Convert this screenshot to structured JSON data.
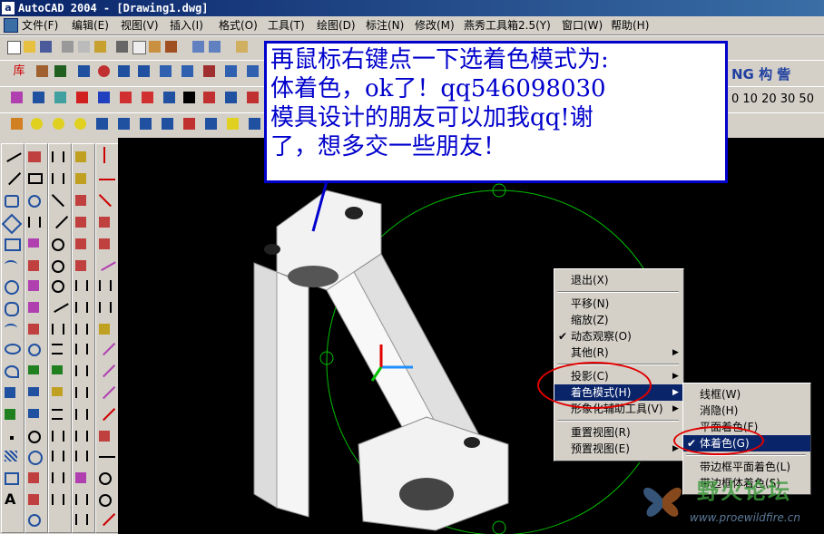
{
  "window": {
    "title": "AutoCAD 2004 - [Drawing1.dwg]",
    "app_icon": "a"
  },
  "menus": [
    "文件(F)",
    "编辑(E)",
    "视图(V)",
    "插入(I)",
    "格式(O)",
    "工具(T)",
    "绘图(D)",
    "标注(N)",
    "修改(M)",
    "燕秀工具箱2.5(Y)",
    "窗口(W)",
    "帮助(H)"
  ],
  "toolbar_right_text": {
    "ng": "NG 构 訾",
    "scale_numbers": "0 10 20 30 50"
  },
  "annotation": {
    "lines": [
      "再鼠标右键点一下选着色模式为:",
      "体着色，ok了！qq546098030",
      "模具设计的朋友可以加我qq!谢",
      "了，想多交一些朋友！"
    ],
    "color": "#0000cc"
  },
  "context_menu": {
    "items": [
      {
        "label": "退出(X)"
      },
      {
        "label": "平移(N)"
      },
      {
        "label": "缩放(Z)"
      },
      {
        "label": "动态观察(O)",
        "checked": true
      },
      {
        "label": "其他(R)",
        "submenu": true
      },
      {
        "label": "投影(C)",
        "submenu": true
      },
      {
        "label": "着色模式(H)",
        "submenu": true,
        "highlighted": true
      },
      {
        "label": "形象化辅助工具(V)",
        "submenu": true
      },
      {
        "label": "重置视图(R)"
      },
      {
        "label": "预置视图(E)",
        "submenu": true
      }
    ]
  },
  "shade_submenu": {
    "items": [
      {
        "label": "线框(W)"
      },
      {
        "label": "消隐(H)"
      },
      {
        "label": "平面着色(F)"
      },
      {
        "label": "体着色(G)",
        "checked": true,
        "highlighted": true
      },
      {
        "label": "带边框平面着色(L)"
      },
      {
        "label": "带边框体着色(S)"
      }
    ]
  },
  "check_mark": "✔",
  "arrow": "▶",
  "watermark": {
    "title": "野火论坛",
    "url": "www.proewildfire.cn"
  },
  "colors": {
    "highlight": "#0a246a",
    "annotation_border": "#0000cc",
    "orbit": "#00c000",
    "marker": "#e00000"
  }
}
